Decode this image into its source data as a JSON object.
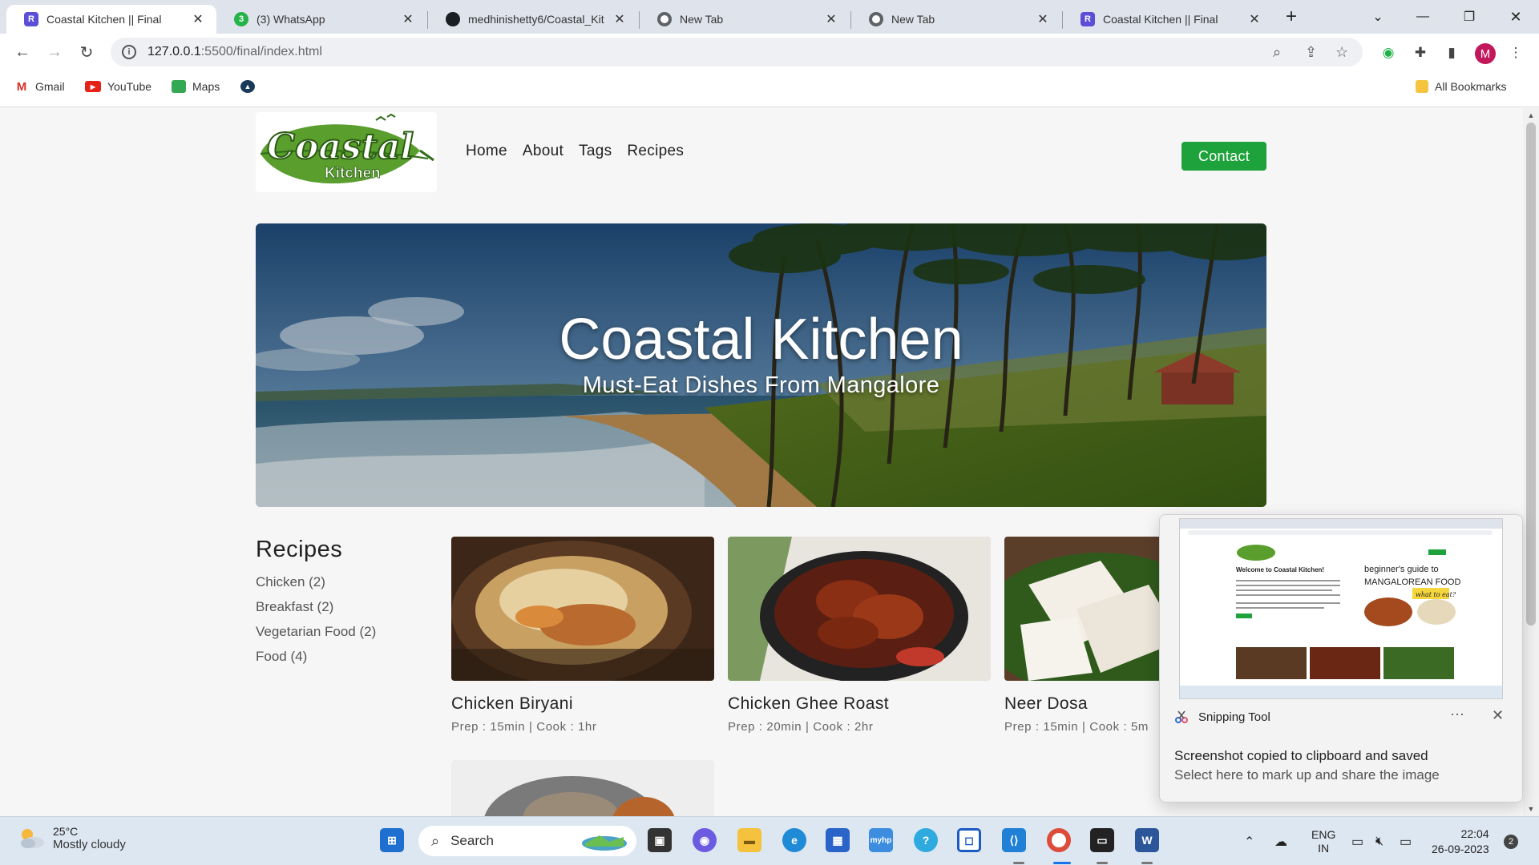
{
  "browser": {
    "tabs": [
      {
        "title": "Coastal Kitchen || Final",
        "favicon": "r-icon",
        "active": true
      },
      {
        "title": "(3) WhatsApp",
        "favicon": "whatsapp-icon",
        "badge": "3"
      },
      {
        "title": "medhinishetty6/Coastal_Kit",
        "favicon": "github-icon"
      },
      {
        "title": "New Tab",
        "favicon": "chrome-icon"
      },
      {
        "title": "New Tab",
        "favicon": "chrome-icon"
      },
      {
        "title": "Coastal Kitchen || Final",
        "favicon": "r-icon"
      }
    ],
    "url_host": "127.0.0.1",
    "url_path": ":5500/final/index.html",
    "profile_initial": "M",
    "bookmarks": [
      {
        "label": "Gmail"
      },
      {
        "label": "YouTube"
      },
      {
        "label": "Maps"
      }
    ],
    "all_bookmarks_label": "All Bookmarks"
  },
  "site": {
    "logo_text_top": "Coastal",
    "logo_text_bottom": "Kitchen",
    "nav": [
      "Home",
      "About",
      "Tags",
      "Recipes"
    ],
    "contact_label": "Contact",
    "hero_title": "Coastal Kitchen",
    "hero_subtitle": "Must-Eat Dishes From Mangalore",
    "sidebar_title": "Recipes",
    "categories": [
      "Chicken (2)",
      "Breakfast (2)",
      "Vegetarian Food (2)",
      "Food (4)"
    ],
    "cards": [
      {
        "name": "Chicken Biryani",
        "meta": "Prep : 15min | Cook : 1hr"
      },
      {
        "name": "Chicken Ghee Roast",
        "meta": "Prep : 20min | Cook : 2hr"
      },
      {
        "name": "Neer Dosa",
        "meta": "Prep : 15min | Cook : 5m"
      }
    ]
  },
  "toast": {
    "app_name": "Snipping Tool",
    "message": "Screenshot copied to clipboard and saved",
    "sub_message": "Select here to mark up and share the image",
    "more": "···",
    "close": "✕",
    "preview": {
      "welcome": "Welcome to Coastal Kitchen!",
      "guide_line1": "beginner's guide to",
      "guide_line2": "MANGALOREAN FOOD",
      "guide_line3": "what to eat?"
    }
  },
  "taskbar": {
    "temperature": "25°C",
    "condition": "Mostly cloudy",
    "search_label": "Search",
    "lang_line1": "ENG",
    "lang_line2": "IN",
    "time": "22:04",
    "date": "26-09-2023",
    "notification_count": "2"
  },
  "colors": {
    "accent_green": "#1ea23b",
    "tab_strip": "#dfe3eb",
    "taskbar": "#dde7f2"
  }
}
